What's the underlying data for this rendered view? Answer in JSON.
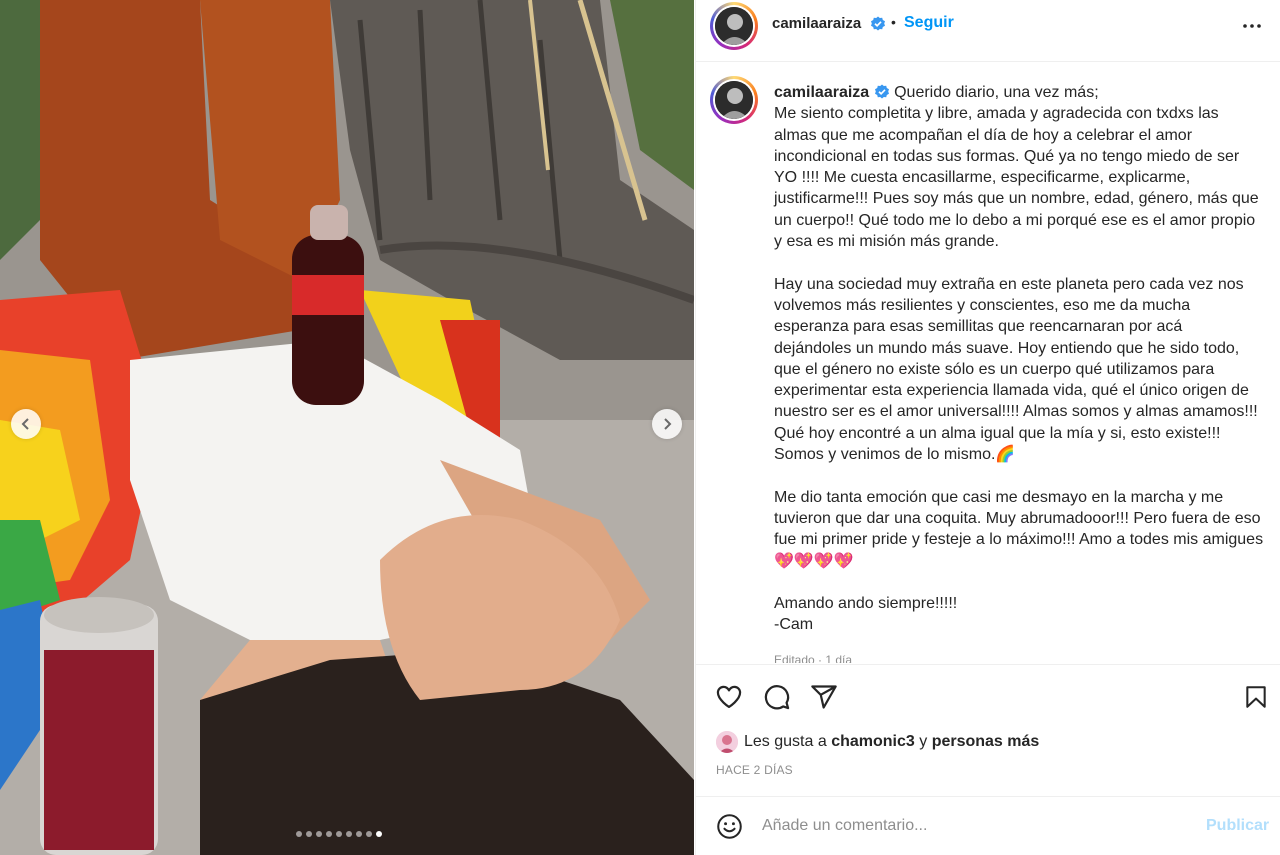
{
  "post": {
    "username": "camilaaraiza",
    "follow_label": "Seguir",
    "separator": "•",
    "verified_icon": "verified-badge-icon",
    "more_icon": "more-options-icon"
  },
  "media": {
    "carousel_count": 9,
    "carousel_active_index": 8,
    "prev_icon": "chevron-left-icon",
    "next_icon": "chevron-right-icon"
  },
  "caption": {
    "username": "camilaaraiza",
    "paragraphs": [
      "Querido diario, una vez más;",
      "Me siento completita y libre, amada y agradecida con txdxs las almas que me acompañan el día de hoy a celebrar el amor incondicional en todas sus formas. Qué ya no tengo miedo de ser YO !!!! Me cuesta encasillarme, especificarme, explicarme, justificarme!!! Pues soy más que un nombre, edad, género, más que un cuerpo!! Qué todo me lo debo a mi porqué ese es el amor propio y esa es mi misión más grande.",
      "Hay una sociedad muy extraña en este planeta pero cada vez nos volvemos más resilientes y conscientes, eso me da mucha esperanza para esas semillitas que reencarnaran por acá dejándoles un mundo más suave. Hoy entiendo que he sido todo, que el género no existe sólo es un cuerpo qué utilizamos para experimentar esta experiencia llamada vida, qué el único origen de nuestro ser es el amor universal!!!! Almas somos y almas amamos!!! Qué hoy encontré a un alma igual que la mía y si, esto existe!!! Somos y venimos de lo mismo.🌈",
      "Me dio tanta emoción que casi me desmayo en la marcha y me tuvieron que dar una coquita. Muy abrumadooor!!! Pero fuera de eso fue mi primer pride y festeje a lo máximo!!! Amo a todes mis amigues💖💖💖💖",
      "Amando ando siempre!!!!!",
      "-Cam"
    ],
    "edited": "Editado · 1 día"
  },
  "actions": {
    "like_icon": "heart-icon",
    "comment_icon": "comment-icon",
    "share_icon": "send-icon",
    "save_icon": "bookmark-icon"
  },
  "likes": {
    "prefix": "Les gusta a",
    "user": "chamonic3",
    "joiner": "y",
    "rest": "personas más"
  },
  "timestamp": "HACE 2 DÍAS",
  "comment_box": {
    "placeholder": "Añade un comentario...",
    "publish_label": "Publicar",
    "emoji_icon": "emoji-icon"
  },
  "colors": {
    "accent": "#0095f6",
    "publish_disabled": "#b2dffc",
    "text": "#262626",
    "muted": "#8e8e8e"
  }
}
